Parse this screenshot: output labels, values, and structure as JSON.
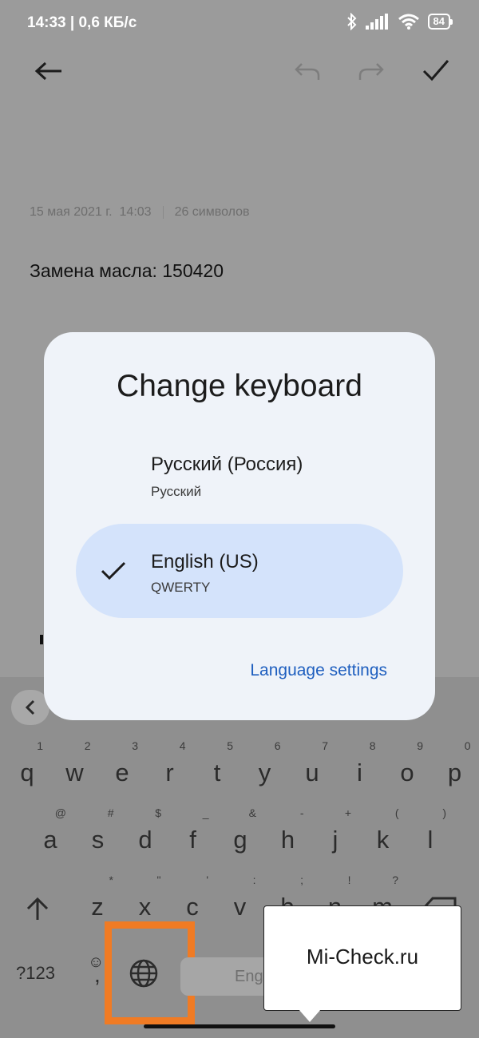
{
  "status_bar": {
    "time": "14:33 | 0,6 КБ/с",
    "battery": "84"
  },
  "note": {
    "date": "15 мая 2021 г.",
    "time": "14:03",
    "char_count": "26 символов",
    "text": "Замена масла: 150420"
  },
  "dialog": {
    "title": "Change keyboard",
    "options": [
      {
        "name": "Русский (Россия)",
        "layout": "Русский",
        "selected": false
      },
      {
        "name": "English (US)",
        "layout": "QWERTY",
        "selected": true
      }
    ],
    "settings_link": "Language settings"
  },
  "keyboard": {
    "row1": [
      "q",
      "w",
      "e",
      "r",
      "t",
      "y",
      "u",
      "i",
      "o",
      "p"
    ],
    "row1_hints": [
      "1",
      "2",
      "3",
      "4",
      "5",
      "6",
      "7",
      "8",
      "9",
      "0"
    ],
    "row2": [
      "a",
      "s",
      "d",
      "f",
      "g",
      "h",
      "j",
      "k",
      "l"
    ],
    "row2_hints": [
      "@",
      "#",
      "$",
      "_",
      "&",
      "-",
      "+",
      "(",
      ")"
    ],
    "row3": [
      "z",
      "x",
      "c",
      "v",
      "b",
      "n",
      "m"
    ],
    "row3_hints": [
      "*",
      "\"",
      "'",
      ":",
      ";",
      "!",
      "?"
    ],
    "numbers_key": "?123",
    "emoji_key": "☺",
    "comma_key": ",",
    "space_label": "Eng"
  },
  "callout": {
    "text": "Mi-Check.ru"
  },
  "colors": {
    "highlight": "#f07b24",
    "selected_option": "#d4e3fb",
    "link": "#1f5fbf"
  }
}
